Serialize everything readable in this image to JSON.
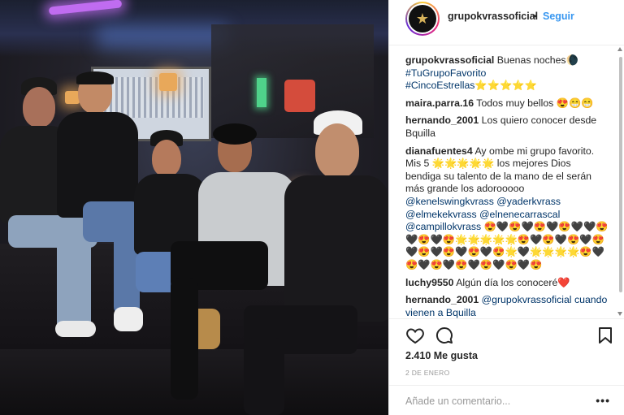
{
  "post": {
    "username": "grupokvrassoficial",
    "separator": "•",
    "follow_label": "Seguir",
    "avatar_icon": "star-logo-icon",
    "more_icon": "•••"
  },
  "comments": [
    {
      "user": "grupokvrassoficial",
      "text": "Buenas noches🌘",
      "tags": [
        "#TuGrupoFavorito"
      ],
      "extra": "#CincoEstrellas⭐⭐⭐⭐⭐"
    },
    {
      "user": "maira.parra.16",
      "text": "Todos muy bellos 😍😁😁"
    },
    {
      "user": "hernando_2001",
      "text": "Los quiero conocer desde Bquilla"
    },
    {
      "user": "dianafuentes4",
      "text": "Ay ombe mi grupo favorito. Mis 5 🌟🌟🌟🌟🌟 los mejores Dios bendiga su talento de la mano de el serán más grande los adorooooo",
      "mentions": "@kenelswingkvrass @yaderkvrass @elmekekvrass @elnenecarrascal @campillokvrass",
      "emoji": "😍🖤😍🖤😍🖤😍🖤🖤😍🖤😍🖤😍🌟🌟🌟🌟🌟😍🖤😍🖤😍🖤😍🖤😍🖤😍🖤😍🖤😍🌟🖤🌟🌟🌟🌟😍🖤😍🖤😍🖤😍🖤😍🖤😍🖤😍"
    },
    {
      "user": "luchy9550",
      "text": "Algún día los conoceré❤️"
    },
    {
      "user": "hernando_2001",
      "text": "@grupokvrassoficial cuando vienen a Bquilla"
    }
  ],
  "likes": "2.410 Me gusta",
  "date": "2 DE ENERO",
  "add_comment": {
    "placeholder": "Añade un comentario..."
  },
  "colors": {
    "link": "#3897f0",
    "tag": "#003569",
    "text": "#262626",
    "muted": "#999999"
  }
}
